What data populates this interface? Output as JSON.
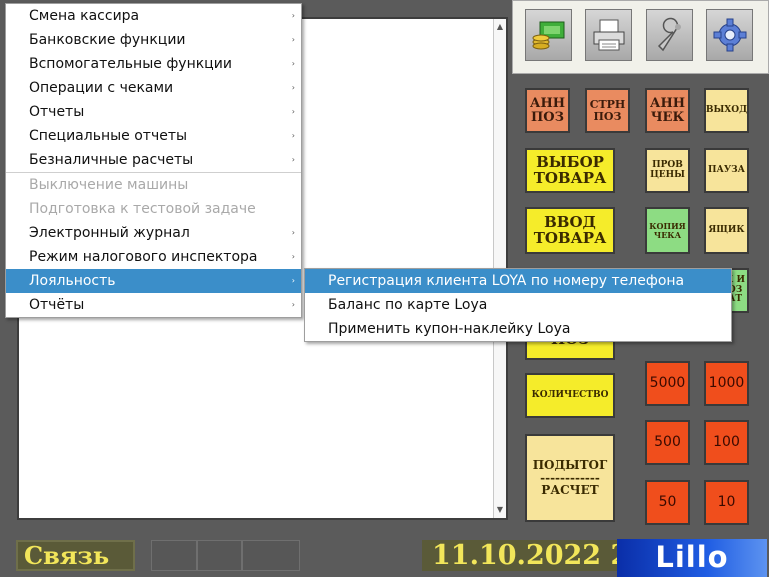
{
  "menu": {
    "items": [
      {
        "label": "Смена кассира",
        "submenu": true
      },
      {
        "label": "Банковские функции",
        "submenu": true
      },
      {
        "label": "Вспомогательные функции",
        "submenu": true
      },
      {
        "label": "Операции с чеками",
        "submenu": true
      },
      {
        "label": "Отчеты",
        "submenu": true
      },
      {
        "label": "Специальные отчеты",
        "submenu": true
      },
      {
        "label": "Безналичные расчеты",
        "submenu": true
      },
      {
        "label": "Выключение машины",
        "disabled": true
      },
      {
        "label": "Подготовка к тестовой задаче",
        "disabled": true
      },
      {
        "label": "Электронный журнал",
        "submenu": true
      },
      {
        "label": "Режим налогового инспектора",
        "submenu": true
      },
      {
        "label": "Лояльность",
        "submenu": true,
        "active": true
      },
      {
        "label": "Отчёты",
        "submenu": true
      }
    ],
    "submenu_arrow": "›"
  },
  "loyalty_menu": {
    "items": [
      {
        "label": "Регистрация клиента LOYA по номеру телефона",
        "active": true
      },
      {
        "label": "Баланс по карте Loya"
      },
      {
        "label": "Применить купон-наклейку Loya"
      }
    ]
  },
  "toolbar": {
    "icons": [
      "money-icon",
      "printer-icon",
      "wrench-icon",
      "gear-icon"
    ]
  },
  "keys": {
    "ann_poz": "АНН\nПОЗ",
    "strn_poz": "СТРН\nПОЗ",
    "ann_chek": "АНН\nЧЕК",
    "vyhod": "ВЫХОД",
    "vybor_tovara": "ВЫБОР\nТОВАРА",
    "prov_ceny": "ПРОВ\nЦЕНЫ",
    "pauza": "ПАУЗА",
    "vvod_tovara": "ВВОД\nТОВАРА",
    "kopiya_cheka": "КОПИЯ\nЧЕКА",
    "yaschik": "ЯЩИК",
    "partial_green": "К И\nОЗ\nАТ",
    "poz": "ПОЗ",
    "kolichestvo": "КОЛИЧЕСТВО",
    "podytog": "ПОДЫТОГ\n------------\nРАСЧЕТ",
    "n5000": "5000",
    "n1000": "1000",
    "n500": "500",
    "n100": "100",
    "n50": "50",
    "n10": "10"
  },
  "status": {
    "connection": "Связь",
    "date": "11.10.2022 2",
    "logo": "Lillo"
  },
  "colors": {
    "menu_highlight": "#3b8ec9",
    "key_orange": "#e98b60",
    "key_yellow": "#f5ec2a",
    "key_red": "#f04e1c"
  }
}
